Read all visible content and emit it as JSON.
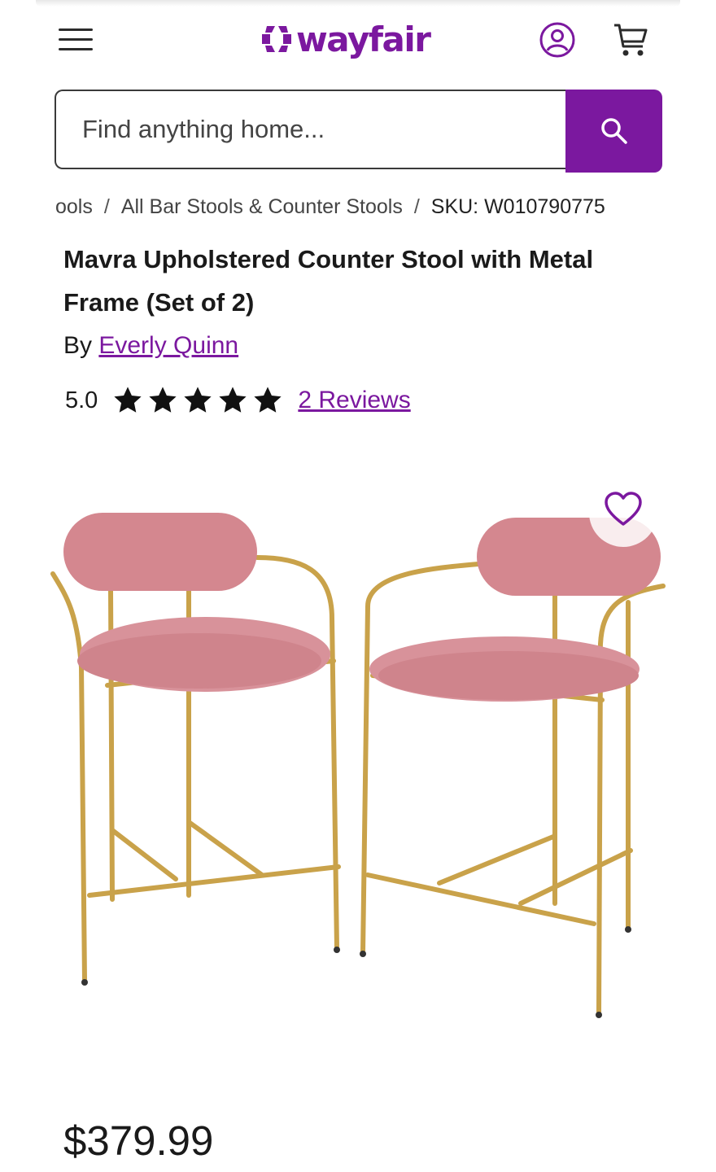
{
  "header": {
    "brand": "wayfair",
    "brand_color": "#7b189f",
    "icons": [
      "menu-icon",
      "wayfair-logo",
      "account-icon",
      "cart-icon"
    ]
  },
  "search": {
    "placeholder": "Find anything home...",
    "button_icon": "search-icon"
  },
  "breadcrumb": {
    "items": [
      "ools",
      "All Bar Stools & Counter Stools"
    ],
    "sku": "SKU: W010790775"
  },
  "product": {
    "title": "Mavra Upholstered Counter Stool with Metal Frame (Set of 2)",
    "by_label": "By",
    "brand": "Everly Quinn",
    "rating": "5.0",
    "stars": 5,
    "reviews_label": "2 Reviews",
    "price": "$379.99",
    "favorite_icon": "heart-icon",
    "image_subject": "Two pink velvet counter stools with gold metal frames"
  }
}
